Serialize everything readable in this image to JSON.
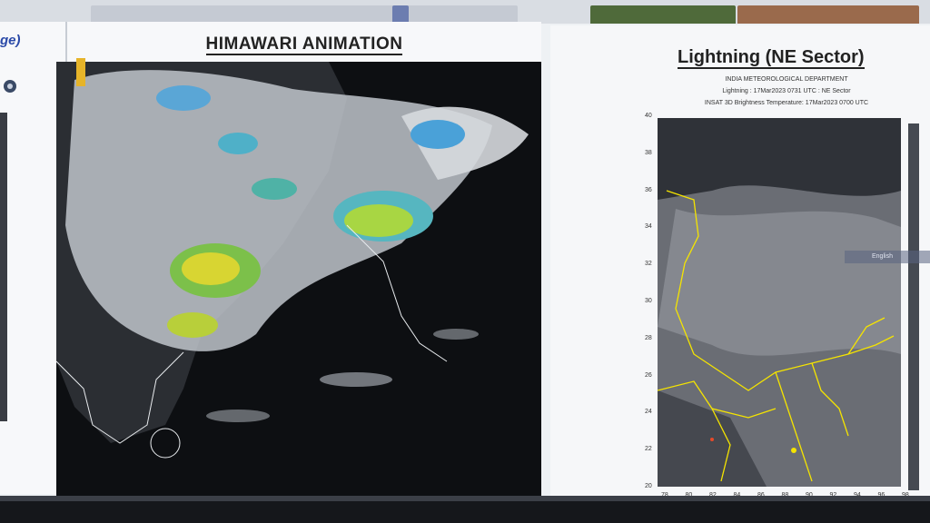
{
  "left_panel": {
    "title_fragment": "ge)"
  },
  "himawari": {
    "title": "HIMAWARI ANIMATION"
  },
  "lightning": {
    "title": "Lightning (NE Sector)",
    "org": "INDIA METEOROLOGICAL DEPARTMENT",
    "line1": "Lightning : 17Mar2023 0731 UTC : NE Sector",
    "line2": "INSAT 3D Brightness Temperature: 17Mar2023 0700 UTC",
    "y_ticks": [
      "40",
      "38",
      "36",
      "34",
      "32",
      "30",
      "28",
      "26",
      "24",
      "22",
      "20"
    ],
    "x_ticks": [
      "78",
      "80",
      "82",
      "84",
      "86",
      "88",
      "90",
      "92",
      "94",
      "96",
      "98"
    ]
  },
  "overlay": {
    "language_label": "English"
  },
  "colors": {
    "boundary": "#f5e400",
    "background": "#eef1f4",
    "dark": "#0d0f12"
  }
}
